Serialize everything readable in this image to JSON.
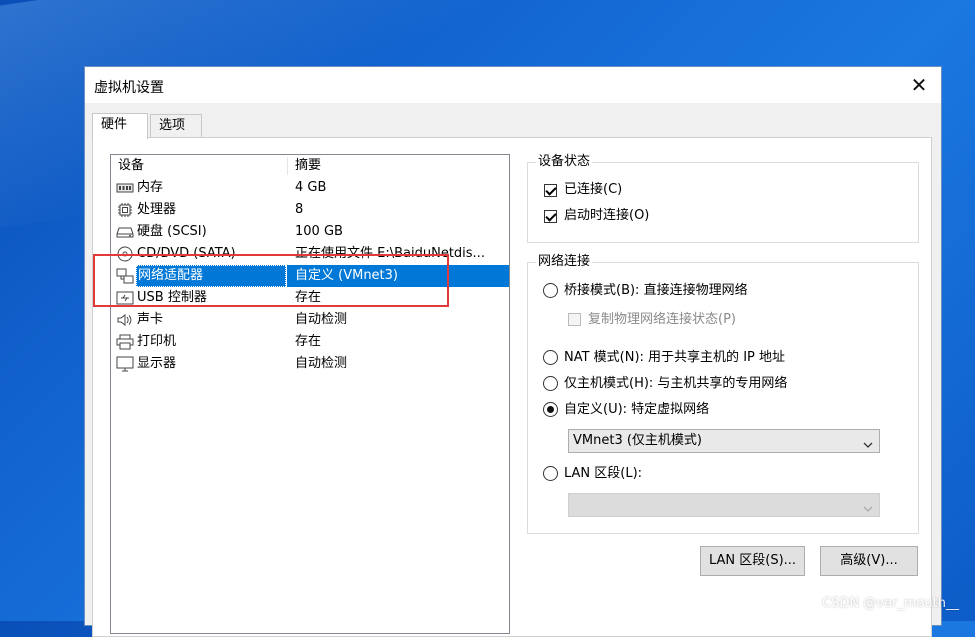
{
  "window": {
    "title": "虚拟机设置"
  },
  "tabs": [
    {
      "label": "硬件",
      "active": true
    },
    {
      "label": "选项",
      "active": false
    }
  ],
  "device_list": {
    "headers": {
      "device": "设备",
      "summary": "摘要"
    },
    "rows": [
      {
        "icon": "memory-icon",
        "device": "内存",
        "summary": "4 GB"
      },
      {
        "icon": "cpu-icon",
        "device": "处理器",
        "summary": "8"
      },
      {
        "icon": "harddisk-icon",
        "device": "硬盘 (SCSI)",
        "summary": "100 GB"
      },
      {
        "icon": "cd-dvd-icon",
        "device": "CD/DVD (SATA)",
        "summary": "正在使用文件 E:\\BaiduNetdis..."
      },
      {
        "icon": "network-adapter-icon",
        "device": "网络适配器",
        "summary": "自定义 (VMnet3)",
        "selected": true
      },
      {
        "icon": "usb-icon",
        "device": "USB 控制器",
        "summary": "存在"
      },
      {
        "icon": "speaker-icon",
        "device": "声卡",
        "summary": "自动检测"
      },
      {
        "icon": "printer-icon",
        "device": "打印机",
        "summary": "存在"
      },
      {
        "icon": "monitor-icon",
        "device": "显示器",
        "summary": "自动检测"
      }
    ]
  },
  "device_status": {
    "title": "设备状态",
    "connected": {
      "label": "已连接(C)",
      "checked": true
    },
    "connect_on_power_on": {
      "label": "启动时连接(O)",
      "checked": true
    }
  },
  "network_connection": {
    "title": "网络连接",
    "bridged": {
      "label": "桥接模式(B): 直接连接物理网络",
      "checked": false
    },
    "replicate": {
      "label": "复制物理网络连接状态(P)",
      "checked": false,
      "disabled": true
    },
    "nat": {
      "label": "NAT 模式(N): 用于共享主机的 IP 地址",
      "checked": false
    },
    "host_only": {
      "label": "仅主机模式(H): 与主机共享的专用网络",
      "checked": false
    },
    "custom": {
      "label": "自定义(U): 特定虚拟网络",
      "checked": true
    },
    "custom_select_value": "VMnet3 (仅主机模式)",
    "lan_segment": {
      "label": "LAN 区段(L):",
      "checked": false
    },
    "lan_select_value": ""
  },
  "buttons": {
    "lan_segments": "LAN 区段(S)...",
    "advanced": "高级(V)..."
  },
  "watermark": "CSDN @ver_mouth__",
  "colors": {
    "selection": "#0078d7",
    "annotation_box": "#e23a3a"
  }
}
